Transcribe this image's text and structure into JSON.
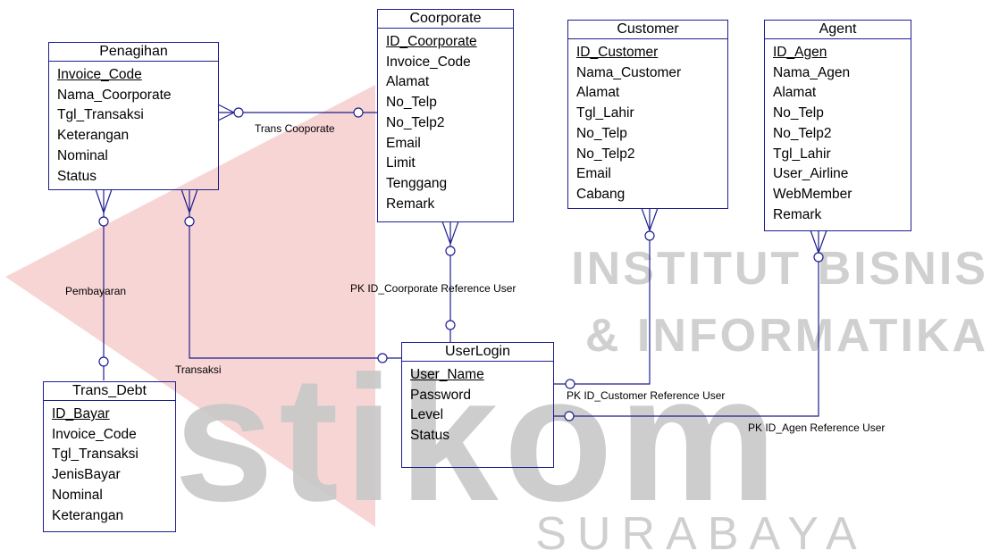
{
  "watermark": {
    "institut_text": "INSTITUT BISNIS",
    "informatika_text": "& INFORMATIKA",
    "logo_text": "stikom",
    "city_text": "SURABAYA",
    "colors": {
      "red": "#f2b2b2",
      "gray": "#c8c8c8"
    }
  },
  "colors": {
    "line": "#1f1f8f",
    "text": "#000000"
  },
  "entities": {
    "penagihan": {
      "title": "Penagihan",
      "attributes": [
        "Invoice_Code",
        "Nama_Coorporate",
        "Tgl_Transaksi",
        "Keterangan",
        "Nominal",
        "Status"
      ]
    },
    "coorporate": {
      "title": "Coorporate",
      "attributes": [
        "ID_Coorporate",
        "Invoice_Code",
        "Alamat",
        "No_Telp",
        "No_Telp2",
        "Email",
        "Limit",
        "Tenggang",
        "Remark"
      ]
    },
    "customer": {
      "title": "Customer",
      "attributes": [
        "ID_Customer",
        "Nama_Customer",
        "Alamat",
        "Tgl_Lahir",
        "No_Telp",
        "No_Telp2",
        "Email",
        "Cabang"
      ]
    },
    "agent": {
      "title": "Agent",
      "attributes": [
        "ID_Agen",
        "Nama_Agen",
        "Alamat",
        "No_Telp",
        "No_Telp2",
        "Tgl_Lahir",
        "User_Airline",
        "WebMember",
        "Remark"
      ]
    },
    "trans_debt": {
      "title": "Trans_Debt",
      "attributes": [
        "ID_Bayar",
        "Invoice_Code",
        "Tgl_Transaksi",
        "JenisBayar",
        "Nominal",
        "Keterangan"
      ]
    },
    "userlogin": {
      "title": "UserLogin",
      "attributes": [
        "User_Name",
        "Password",
        "Level",
        "Status"
      ]
    }
  },
  "relationships": {
    "trans_cooporate": "Trans Cooporate",
    "pembayaran": "Pembayaran",
    "transaksi": "Transaksi",
    "coorporate_ref": "PK ID_Coorporate Reference User",
    "customer_ref": "PK ID_Customer Reference User",
    "agen_ref": "PK ID_Agen Reference User"
  }
}
